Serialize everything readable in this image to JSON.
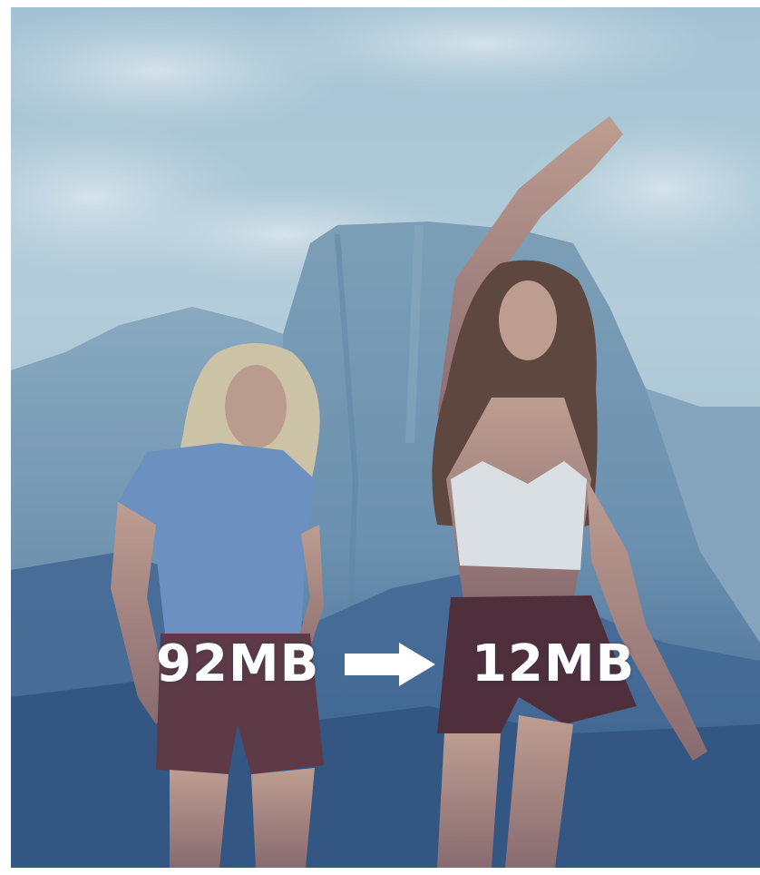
{
  "image": {
    "subject": "photo",
    "palette": {
      "sky": "#9bbfd0",
      "mountain": "#6f93ad",
      "shadow": "#2f4f7a",
      "overlay_text": "#ffffff"
    }
  },
  "overlay": {
    "before_size": "92MB",
    "after_size": "12MB",
    "arrow_icon": "right-arrow-icon"
  }
}
